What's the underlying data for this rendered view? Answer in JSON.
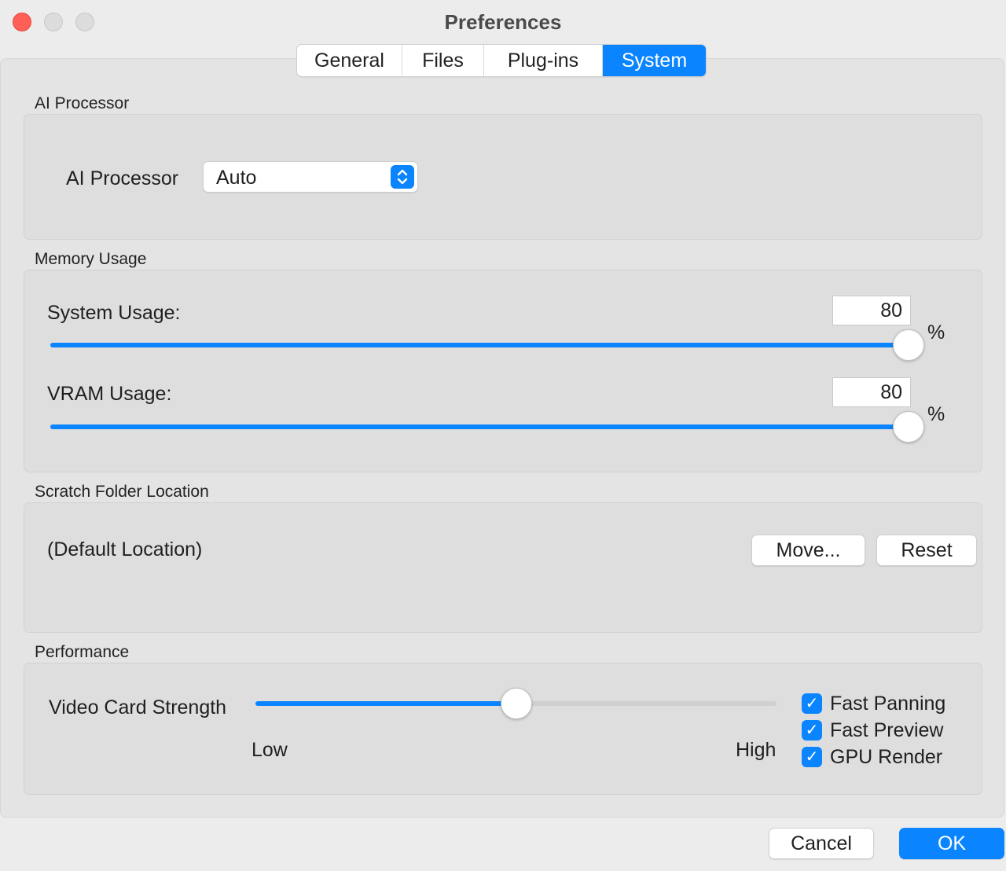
{
  "window": {
    "title": "Preferences"
  },
  "tabs": [
    {
      "label": "General",
      "active": false
    },
    {
      "label": "Files",
      "active": false
    },
    {
      "label": "Plug-ins",
      "active": false
    },
    {
      "label": "System",
      "active": true
    }
  ],
  "ai_processor": {
    "section_title": "AI Processor",
    "label": "AI Processor",
    "value": "Auto"
  },
  "memory": {
    "section_title": "Memory Usage",
    "system": {
      "label": "System Usage:",
      "value": "80",
      "unit": "%",
      "percent": 80
    },
    "vram": {
      "label": "VRAM Usage:",
      "value": "80",
      "unit": "%",
      "percent": 80
    }
  },
  "scratch": {
    "section_title": "Scratch Folder Location",
    "location": "(Default Location)",
    "move_label": "Move...",
    "reset_label": "Reset"
  },
  "performance": {
    "section_title": "Performance",
    "label": "Video Card Strength",
    "low_label": "Low",
    "high_label": "High",
    "strength_fraction": 0.5,
    "checks": [
      {
        "label": "Fast Panning",
        "checked": true
      },
      {
        "label": "Fast Preview",
        "checked": true
      },
      {
        "label": "GPU Render",
        "checked": true
      }
    ]
  },
  "footer": {
    "cancel_label": "Cancel",
    "ok_label": "OK"
  },
  "colors": {
    "accent": "#0a84ff",
    "close": "#ff5f57"
  },
  "icons": {
    "popup": "up-down-chevron-icon",
    "check": "checkmark-icon"
  }
}
